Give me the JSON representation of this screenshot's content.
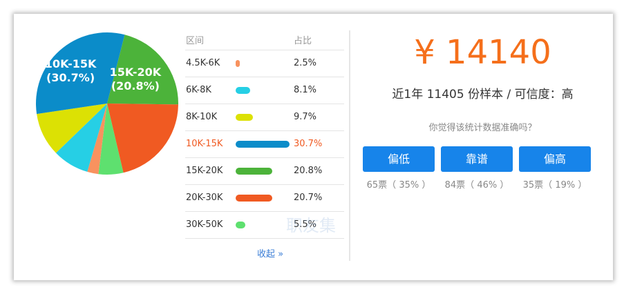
{
  "chart_data": {
    "type": "pie",
    "categories": [
      "4.5K-6K",
      "6K-8K",
      "8K-10K",
      "10K-15K",
      "15K-20K",
      "20K-30K",
      "30K-50K"
    ],
    "values": [
      2.5,
      8.1,
      9.7,
      30.7,
      20.8,
      20.7,
      5.5
    ],
    "colors": [
      "#f8925f",
      "#26cfe5",
      "#dce104",
      "#0b8cc9",
      "#4cb33a",
      "#f05a22",
      "#5ee06f"
    ],
    "pie_labels": [
      {
        "line1": "10K-15K",
        "line2": "(30.7%)"
      },
      {
        "line1": "15K-20K",
        "line2": "(20.8%)"
      }
    ]
  },
  "table": {
    "header_range": "区间",
    "header_pct": "占比",
    "rows": [
      {
        "range": "4.5K-6K",
        "pct": "2.5%",
        "value": 2.5,
        "color": "#f8925f"
      },
      {
        "range": "6K-8K",
        "pct": "8.1%",
        "value": 8.1,
        "color": "#26cfe5"
      },
      {
        "range": "8K-10K",
        "pct": "9.7%",
        "value": 9.7,
        "color": "#dce104"
      },
      {
        "range": "10K-15K",
        "pct": "30.7%",
        "value": 30.7,
        "color": "#0b8cc9"
      },
      {
        "range": "15K-20K",
        "pct": "20.8%",
        "value": 20.8,
        "color": "#4cb33a"
      },
      {
        "range": "20K-30K",
        "pct": "20.7%",
        "value": 20.7,
        "color": "#f05a22"
      },
      {
        "range": "30K-50K",
        "pct": "5.5%",
        "value": 5.5,
        "color": "#5ee06f"
      }
    ],
    "collapse_label": "收起 »"
  },
  "summary": {
    "salary": "¥ 14140",
    "sample_text": "近1年 11405 份样本 / 可信度：高",
    "question": "你觉得该统计数据准确吗？"
  },
  "votes": [
    {
      "label": "偏低",
      "count": "65票（ 35% ）"
    },
    {
      "label": "靠谱",
      "count": "84票（ 46% ）"
    },
    {
      "label": "偏高",
      "count": "35票（ 19% ）"
    }
  ],
  "watermark": "职友集",
  "colors": {
    "accent": "#f56f1b",
    "button": "#1784ea",
    "link": "#3a7dd6"
  }
}
